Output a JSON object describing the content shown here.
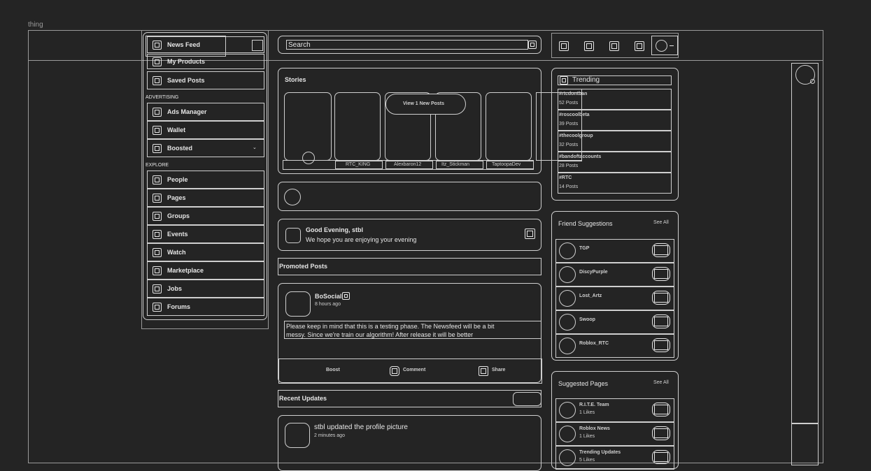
{
  "frame_label": "thing",
  "sidebar": {
    "items": [
      {
        "label": "News Feed",
        "icon": "news-feed-icon"
      },
      {
        "label": "My Products",
        "icon": "products-icon"
      },
      {
        "label": "Saved Posts",
        "icon": "bookmark-icon"
      }
    ],
    "advertising_header": "ADVERTISING",
    "advertising": [
      {
        "label": "Ads Manager",
        "icon": "ads-manager-icon"
      },
      {
        "label": "Wallet",
        "icon": "wallet-icon"
      },
      {
        "label": "Boosted",
        "icon": "boosted-icon"
      }
    ],
    "explore_header": "EXPLORE",
    "explore": [
      {
        "label": "People",
        "icon": "people-icon"
      },
      {
        "label": "Pages",
        "icon": "pages-icon"
      },
      {
        "label": "Groups",
        "icon": "groups-icon"
      },
      {
        "label": "Events",
        "icon": "events-icon"
      },
      {
        "label": "Watch",
        "icon": "watch-icon"
      },
      {
        "label": "Marketplace",
        "icon": "marketplace-icon"
      },
      {
        "label": "Jobs",
        "icon": "jobs-icon"
      },
      {
        "label": "Forums",
        "icon": "forums-icon"
      }
    ]
  },
  "search": {
    "placeholder": "Search"
  },
  "stories": {
    "title": "Stories",
    "view_new": "View 1 New Posts",
    "names": [
      "RTC_KING",
      "Alexbaron12",
      "Itz_Stickman",
      "TaptoopaDev"
    ]
  },
  "greeting": {
    "title": "Good Evening, stbl",
    "subtitle": "We hope you are enjoying your evening"
  },
  "promoted": {
    "header": "Promoted Posts"
  },
  "post": {
    "author": "BoSocial",
    "time": "8 hours ago",
    "text_line1": "Please keep in mind that this is a testing phase. The Newsfeed will be a bit",
    "text_line2": "messy. Since we're train our algorithm! After release it will be better",
    "actions": {
      "boost": "Boost",
      "comment": "Comment",
      "share": "Share"
    }
  },
  "recent": {
    "header": "Recent Updates",
    "item": {
      "title": "stbl updated the profile picture",
      "time": "2 minutes ago"
    }
  },
  "trending": {
    "title": "Trending",
    "items": [
      {
        "tag": "#rtcdontban",
        "count": "52 Posts"
      },
      {
        "tag": "#roscoolbeta",
        "count": "39 Posts"
      },
      {
        "tag": "#thecoolgroup",
        "count": "32 Posts"
      },
      {
        "tag": "#bandoftaccounts",
        "count": "28 Posts"
      },
      {
        "tag": "#RTC",
        "count": "14 Posts"
      }
    ]
  },
  "friends": {
    "title": "Friend Suggestions",
    "see_all": "See All",
    "items": [
      "TGP",
      "DiscyPurple",
      "Lost_Artz",
      "Swoop",
      "Roblox_RTC"
    ]
  },
  "pages": {
    "title": "Suggested Pages",
    "see_all": "See All",
    "items": [
      {
        "name": "R.I.T.E. Team",
        "likes": "1 Likes"
      },
      {
        "name": "Roblox News",
        "likes": "1 Likes"
      },
      {
        "name": "Trending Updates",
        "likes": "5 Likes"
      }
    ]
  }
}
